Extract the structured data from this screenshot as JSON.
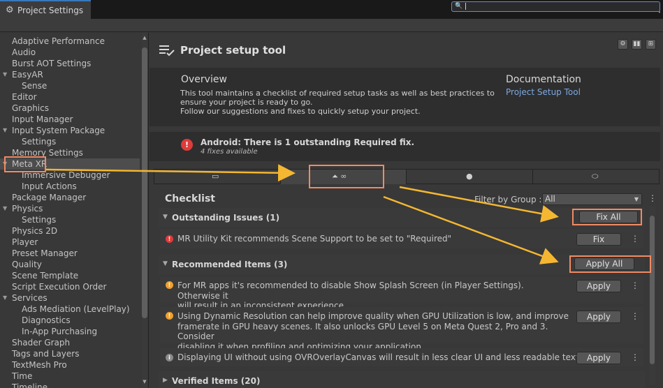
{
  "window": {
    "tab_title": "Project Settings",
    "tab_icon": "gear-icon",
    "menu_icon": "kebab-menu-icon"
  },
  "search": {
    "placeholder": "",
    "icon": "search-icon"
  },
  "sidebar": {
    "items": [
      {
        "label": "Adaptive Performance",
        "indent": 0
      },
      {
        "label": "Audio",
        "indent": 0
      },
      {
        "label": "Burst AOT Settings",
        "indent": 0
      },
      {
        "label": "EasyAR",
        "indent": 0,
        "foldout": "expanded"
      },
      {
        "label": "Sense",
        "indent": 1
      },
      {
        "label": "Editor",
        "indent": 0
      },
      {
        "label": "Graphics",
        "indent": 0
      },
      {
        "label": "Input Manager",
        "indent": 0
      },
      {
        "label": "Input System Package",
        "indent": 0,
        "foldout": "expanded"
      },
      {
        "label": "Settings",
        "indent": 1
      },
      {
        "label": "Memory Settings",
        "indent": 0
      },
      {
        "label": "Meta XR",
        "indent": 0,
        "foldout": "expanded",
        "selected": true
      },
      {
        "label": "Immersive Debugger",
        "indent": 1
      },
      {
        "label": "Input Actions",
        "indent": 1
      },
      {
        "label": "Package Manager",
        "indent": 0
      },
      {
        "label": "Physics",
        "indent": 0,
        "foldout": "expanded"
      },
      {
        "label": "Settings",
        "indent": 1
      },
      {
        "label": "Physics 2D",
        "indent": 0
      },
      {
        "label": "Player",
        "indent": 0
      },
      {
        "label": "Preset Manager",
        "indent": 0
      },
      {
        "label": "Quality",
        "indent": 0
      },
      {
        "label": "Scene Template",
        "indent": 0
      },
      {
        "label": "Script Execution Order",
        "indent": 0
      },
      {
        "label": "Services",
        "indent": 0,
        "foldout": "expanded"
      },
      {
        "label": "Ads Mediation (LevelPlay)",
        "indent": 1
      },
      {
        "label": "Diagnostics",
        "indent": 1
      },
      {
        "label": "In-App Purchasing",
        "indent": 1
      },
      {
        "label": "Shader Graph",
        "indent": 0
      },
      {
        "label": "Tags and Layers",
        "indent": 0
      },
      {
        "label": "TextMesh Pro",
        "indent": 0
      },
      {
        "label": "Time",
        "indent": 0
      },
      {
        "label": "Timeline",
        "indent": 0
      }
    ]
  },
  "header": {
    "title": "Project setup tool",
    "icon": "checklist-icon",
    "buttons": [
      "settings-icon",
      "layout-icon",
      "preset-icon"
    ]
  },
  "overview": {
    "title": "Overview",
    "text_1": "This tool maintains a checklist of required setup tasks as well as best practices to",
    "text_2": "ensure your project is ready to go.",
    "text_3": "Follow our suggestions and fixes to quickly setup your project.",
    "doc_title": "Documentation",
    "doc_link": "Project Setup Tool"
  },
  "alert": {
    "title": "Android: There is 1 outstanding Required fix.",
    "subtitle": "4 fixes available"
  },
  "platform_tabs": [
    {
      "icon": "desktop-icon",
      "active": false
    },
    {
      "icon": "android-meta-icon",
      "active": true
    },
    {
      "icon": "apple-icon",
      "active": false
    },
    {
      "icon": "vr-headset-icon",
      "active": false
    }
  ],
  "checklist": {
    "title": "Checklist",
    "filter_label": "Filter by Group :",
    "filter_value": "All"
  },
  "outstanding": {
    "title": "Outstanding Issues (1)",
    "fix_all": "Fix All",
    "items": [
      {
        "text": "MR Utility Kit recommends Scene Support to be set to \"Required\"",
        "button": "Fix",
        "level": "error"
      }
    ]
  },
  "recommended": {
    "title": "Recommended Items (3)",
    "apply_all": "Apply All",
    "items": [
      {
        "line1": "For MR apps it's recommended to disable Show Splash Screen (in Player Settings). Otherwise it",
        "line2": "will result in an inconsistent experience",
        "button": "Apply",
        "level": "warning"
      },
      {
        "line1": "Using Dynamic Resolution can help improve quality when GPU Utilization is low, and improve",
        "line2": "framerate in GPU heavy scenes. It also unlocks GPU Level 5 on Meta Quest 2, Pro and 3. Consider",
        "line3": "disabling it when profiling and optimizing your application.",
        "button": "Apply",
        "level": "warning"
      },
      {
        "line1": "Displaying UI without using OVROverlayCanvas will result in less clear UI and less readable text.",
        "button": "Apply",
        "level": "info"
      }
    ]
  },
  "verified": {
    "title": "Verified Items (20)"
  },
  "colors": {
    "highlight": "#f28a63",
    "arrow": "#f5b731",
    "error": "#e03b3b",
    "warning": "#f0a030",
    "link": "#7da8e0"
  }
}
